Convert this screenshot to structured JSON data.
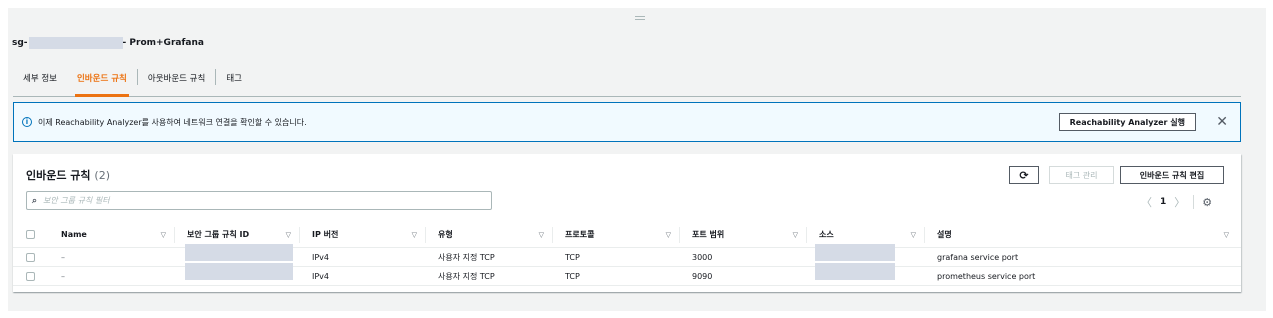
{
  "header": {
    "sg_prefix": "sg-",
    "sg_suffix": "- Prom+Grafana"
  },
  "tabs": [
    {
      "label": "세부 정보",
      "active": false
    },
    {
      "label": "인바운드 규칙",
      "active": true
    },
    {
      "label": "아웃바운드 규칙",
      "active": false
    },
    {
      "label": "태그",
      "active": false
    }
  ],
  "info": {
    "icon": "info-icon",
    "message": "이제 Reachability Analyzer를 사용하여 네트워크 연결을 확인할 수 있습니다.",
    "button_label": "Reachability Analyzer 실행",
    "close_glyph": "✕"
  },
  "inbound": {
    "title": "인바운드 규칙",
    "count": "(2)",
    "refresh_glyph": "⟳",
    "manage_tags_label": "태그 관리",
    "edit_label": "인바운드 규칙 편집",
    "search_placeholder": "보안 그룹 규칙 필터",
    "pager": {
      "prev": "〈",
      "page": "1",
      "next": "〉"
    },
    "gear_glyph": "⚙",
    "columns": [
      "Name",
      "보안 그룹 규칙 ID",
      "IP 버전",
      "유형",
      "프로토콜",
      "포트 범위",
      "소스",
      "설명"
    ],
    "sort_glyph": "▽",
    "rows": [
      {
        "name": "–",
        "ip_version": "IPv4",
        "type": "사용자 지정 TCP",
        "protocol": "TCP",
        "port": "3000",
        "description": "grafana service port"
      },
      {
        "name": "–",
        "ip_version": "IPv4",
        "type": "사용자 지정 TCP",
        "protocol": "TCP",
        "port": "9090",
        "description": "prometheus service port"
      }
    ]
  },
  "colors": {
    "accent": "#ec7211",
    "info_border": "#0073bb",
    "info_bg": "#f1faff",
    "redaction": "#d5dbe6"
  }
}
